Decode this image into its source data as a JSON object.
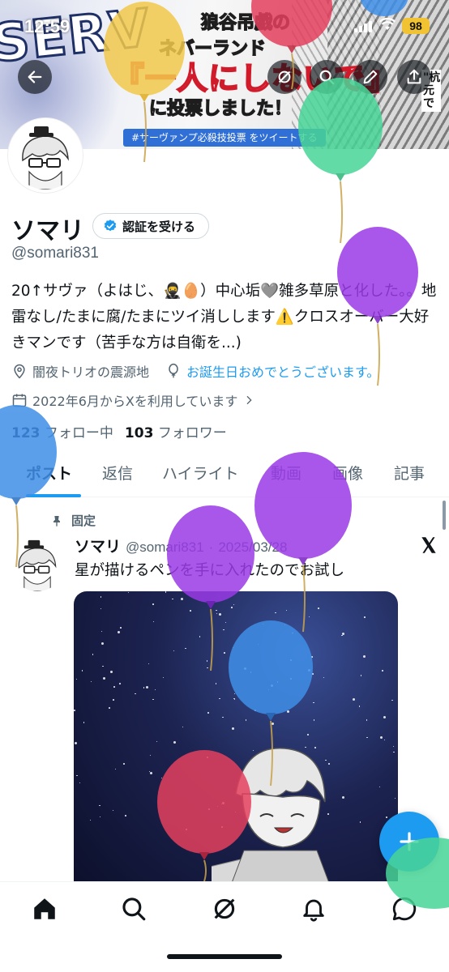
{
  "status_bar": {
    "time": "12:59",
    "battery": "98"
  },
  "banner": {
    "big_word": "SERV",
    "line1": "狼谷吊戯の",
    "line2": "ネバーランド",
    "line3": "『一人にしないで』",
    "line4": "に投票しました！",
    "hashtag": "#サーヴァンプ必殺技投票 をツイートする",
    "side_text": "\"杭元で"
  },
  "header": {
    "back_icon": "arrow-left-icon",
    "grok_icon": "grok-icon",
    "search_icon": "search-icon",
    "edit_icon": "pen-icon",
    "share_icon": "share-icon"
  },
  "profile": {
    "name": "ソマリ",
    "verify_button_label": "認証を受ける",
    "handle": "@somari831",
    "bio": "20↑サヴァ（よはじ、🥷🥚）中心垢🩶雑多草原と化した。。地雷なし/たまに腐/たまにツイ消しします⚠️クロスオーバー大好きマンです（苦手な方は自衛を...)",
    "location": "闇夜トリオの震源地",
    "birthday": "お誕生日おめでとうございます。",
    "joined": "2022年6月からXを利用しています",
    "following_count": "123",
    "following_label": "フォロー中",
    "followers_count": "103",
    "followers_label": "フォロワー"
  },
  "tabs": [
    {
      "label": "ポスト",
      "active": true
    },
    {
      "label": "返信",
      "active": false
    },
    {
      "label": "ハイライト",
      "active": false
    },
    {
      "label": "動画",
      "active": false
    },
    {
      "label": "画像",
      "active": false
    },
    {
      "label": "記事",
      "active": false
    }
  ],
  "pinned_post": {
    "pinned_label": "固定",
    "author_name": "ソマリ",
    "author_handle": "@somari831",
    "date": "2025/03/28",
    "text": "星が描けるペンを手に入れたのでお試し"
  },
  "colors": {
    "accent": "#1d9bf0",
    "text": "#0f1419",
    "secondary": "#536471"
  }
}
